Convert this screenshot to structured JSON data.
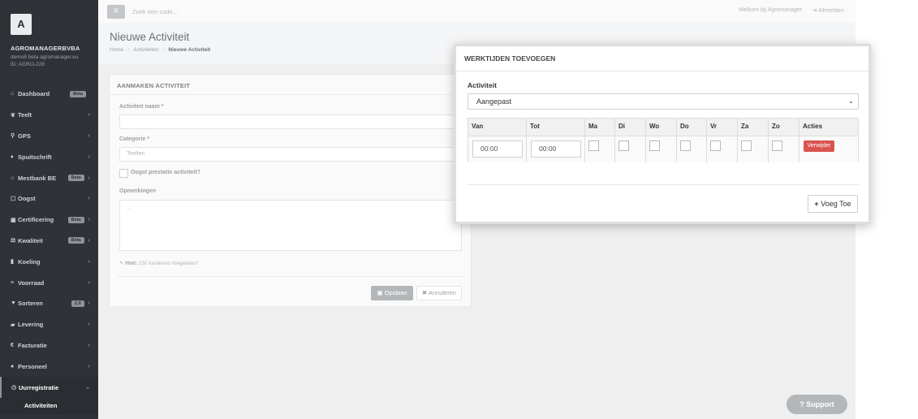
{
  "sidebar": {
    "avatar_letter": "A",
    "company": "AGROMANAGERBVBA",
    "email": "demo8 beta agromanager.eu",
    "id": "ID: AGRO-228",
    "items": [
      {
        "icon": "home-icon",
        "glyph": "⌂",
        "label": "Dashboard",
        "badge": "Beta",
        "chevron": ""
      },
      {
        "icon": "leaf-icon",
        "glyph": "❦",
        "label": "Teelt",
        "badge": "",
        "chevron": "‹"
      },
      {
        "icon": "map-marker-icon",
        "glyph": "⚲",
        "label": "GPS",
        "badge": "",
        "chevron": "‹"
      },
      {
        "icon": "flask-icon",
        "glyph": "♦",
        "label": "Spuitschrift",
        "badge": "",
        "chevron": "‹"
      },
      {
        "icon": "bank-icon",
        "glyph": "⌂",
        "label": "Mestbank BE",
        "badge": "Beta",
        "chevron": "‹"
      },
      {
        "icon": "basket-icon",
        "glyph": "☐",
        "label": "Oogst",
        "badge": "",
        "chevron": "‹"
      },
      {
        "icon": "certificate-icon",
        "glyph": "▣",
        "label": "Certificering",
        "badge": "Beta",
        "chevron": "‹"
      },
      {
        "icon": "balance-icon",
        "glyph": "⚖",
        "label": "Kwaliteit",
        "badge": "Beta",
        "chevron": "‹"
      },
      {
        "icon": "thermometer-icon",
        "glyph": "▮",
        "label": "Koeling",
        "badge": "",
        "chevron": "‹"
      },
      {
        "icon": "list-icon",
        "glyph": "≡",
        "label": "Voorraad",
        "badge": "",
        "chevron": "‹"
      },
      {
        "icon": "filter-icon",
        "glyph": "▼",
        "label": "Sorteren",
        "badge": "2.0",
        "chevron": "‹"
      },
      {
        "icon": "truck-icon",
        "glyph": "▰",
        "label": "Levering",
        "badge": "",
        "chevron": "‹"
      },
      {
        "icon": "euro-icon",
        "glyph": "€",
        "label": "Facturatie",
        "badge": "",
        "chevron": "‹"
      },
      {
        "icon": "user-icon",
        "glyph": "●",
        "label": "Personeel",
        "badge": "",
        "chevron": "‹"
      },
      {
        "icon": "clock-icon",
        "glyph": "◷",
        "label": "Uurregistratie",
        "badge": "",
        "chevron": "⌄"
      }
    ],
    "sub_active": "Activiteiten"
  },
  "topbar": {
    "menu_glyph": "≡",
    "search_placeholder": "Zoek een code...",
    "welcome": "Welkom bij Agromanager",
    "logout": "Afmelden"
  },
  "header": {
    "title": "Nieuwe Activiteit",
    "breadcrumb": [
      "Home",
      "Activiteiten",
      "Nieuwe Activiteit"
    ]
  },
  "form": {
    "panel_title": "AANMAKEN ACTIVITEIT",
    "name_label": "Activiteit naam *",
    "name_value": "",
    "category_label": "Categorie *",
    "category_value": "Teelten",
    "harvest_label": "Oogst prestatie activiteit?",
    "remarks_label": "Opmerkingen",
    "remarks_placeholder": "...",
    "hint_label": "Hint:",
    "hint_text": "250 karakters toegelaten!",
    "save_label": "Opslaan",
    "cancel_label": "Annuleren"
  },
  "support": {
    "label": "Support"
  },
  "modal": {
    "title": "WERKTIJDEN TOEVOEGEN",
    "activity_label": "Activiteit",
    "activity_value": "Aangepast",
    "columns": [
      "Van",
      "Tot",
      "Ma",
      "Di",
      "Wo",
      "Do",
      "Vr",
      "Za",
      "Zo",
      "Acties"
    ],
    "row": {
      "van": "00:00",
      "tot": "00:00",
      "delete_label": "Verwijder"
    },
    "add_label": "Voeg Toe"
  }
}
